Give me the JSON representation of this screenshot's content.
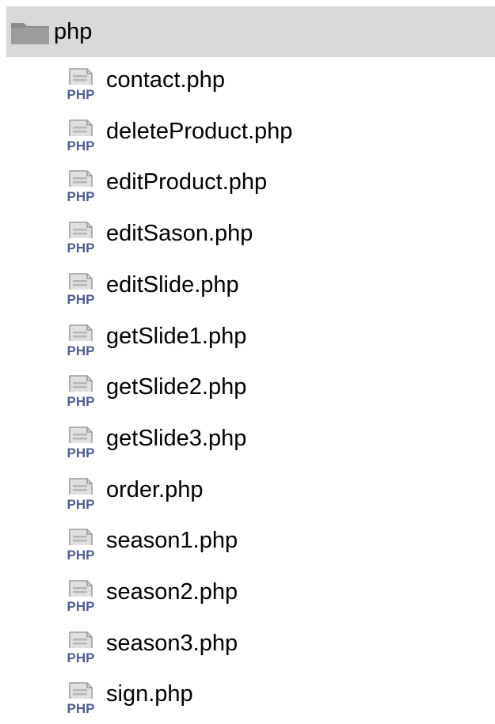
{
  "folder": {
    "name": "php",
    "icon": "folder-icon"
  },
  "files": [
    {
      "name": "contact.php",
      "icon": "php-file-icon"
    },
    {
      "name": "deleteProduct.php",
      "icon": "php-file-icon"
    },
    {
      "name": "editProduct.php",
      "icon": "php-file-icon"
    },
    {
      "name": "editSason.php",
      "icon": "php-file-icon"
    },
    {
      "name": "editSlide.php",
      "icon": "php-file-icon"
    },
    {
      "name": "getSlide1.php",
      "icon": "php-file-icon"
    },
    {
      "name": "getSlide2.php",
      "icon": "php-file-icon"
    },
    {
      "name": "getSlide3.php",
      "icon": "php-file-icon"
    },
    {
      "name": "order.php",
      "icon": "php-file-icon"
    },
    {
      "name": "season1.php",
      "icon": "php-file-icon"
    },
    {
      "name": "season2.php",
      "icon": "php-file-icon"
    },
    {
      "name": "season3.php",
      "icon": "php-file-icon"
    },
    {
      "name": "sign.php",
      "icon": "php-file-icon"
    }
  ],
  "icon_text": "PHP",
  "colors": {
    "selection_bg": "#d9d9d9",
    "folder": "#8a8a8a",
    "php_badge": "#4f5d95",
    "php_doc": "#9a9a9a"
  }
}
